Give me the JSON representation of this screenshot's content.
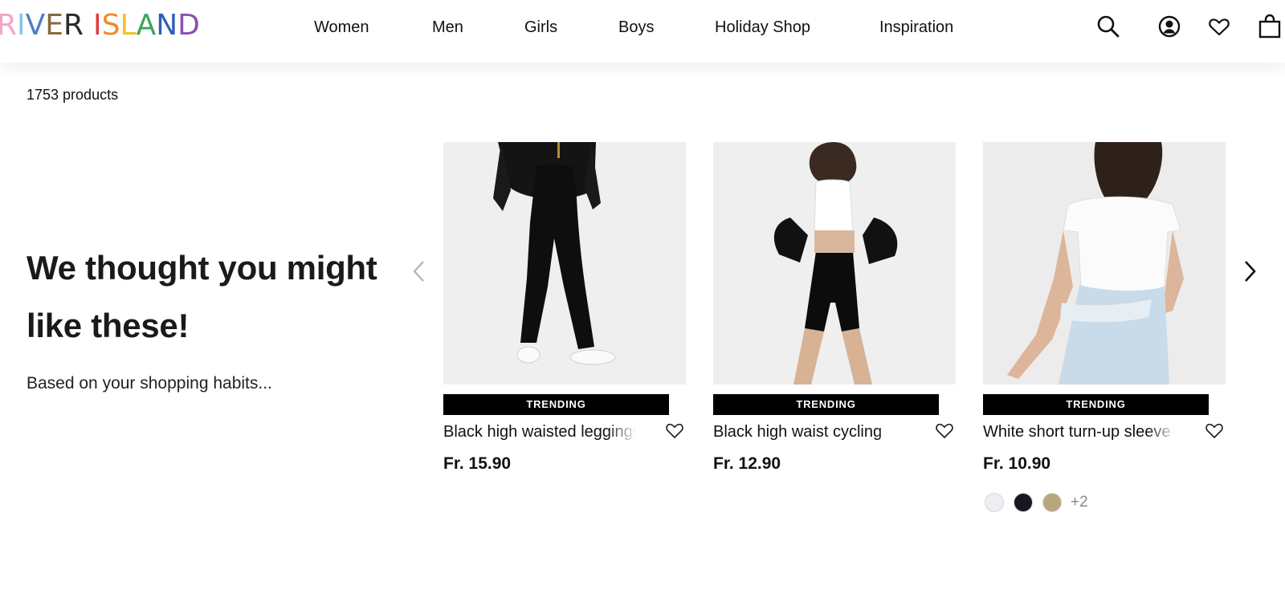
{
  "brand": {
    "logo_letters": [
      {
        "char": "R",
        "color": "#f2a6c8"
      },
      {
        "char": "I",
        "color": "#7ec7e8"
      },
      {
        "char": "V",
        "color": "#4f7fc4"
      },
      {
        "char": "E",
        "color": "#8a6a3c"
      },
      {
        "char": "R",
        "color": "#2b2b2b"
      },
      {
        "char": " ",
        "color": "#ffffff"
      },
      {
        "char": "I",
        "color": "#e23c3c"
      },
      {
        "char": "S",
        "color": "#f08a24"
      },
      {
        "char": "L",
        "color": "#f3c320"
      },
      {
        "char": "A",
        "color": "#3aa65a"
      },
      {
        "char": "N",
        "color": "#2e5fb8"
      },
      {
        "char": "D",
        "color": "#8e4fb0"
      }
    ]
  },
  "nav": {
    "items": [
      {
        "label": "Women"
      },
      {
        "label": "Men"
      },
      {
        "label": "Girls"
      },
      {
        "label": "Boys"
      },
      {
        "label": "Holiday Shop"
      },
      {
        "label": "Inspiration"
      }
    ]
  },
  "header_icons": [
    "search-icon",
    "account-icon",
    "wishlist-icon",
    "bag-icon"
  ],
  "listing": {
    "count": "1753 products"
  },
  "recommendations": {
    "headline": "We thought you might like these!",
    "subline": "Based on your shopping habits...",
    "prev_icon": "chevron-left-icon",
    "next_icon": "chevron-right-icon",
    "products": [
      {
        "badge": "TRENDING",
        "name": "Black high waisted leggings",
        "price": "Fr. 15.90",
        "swatches": [],
        "more": ""
      },
      {
        "badge": "TRENDING",
        "name": "Black high waist cycling",
        "price": "Fr. 12.90",
        "swatches": [],
        "more": ""
      },
      {
        "badge": "TRENDING",
        "name": "White short turn-up sleeve",
        "price": "Fr. 10.90",
        "swatches": [
          {
            "color": "#eceef2"
          },
          {
            "color": "#16181f"
          },
          {
            "color": "#b9a57e"
          }
        ],
        "more": "+2"
      }
    ]
  }
}
